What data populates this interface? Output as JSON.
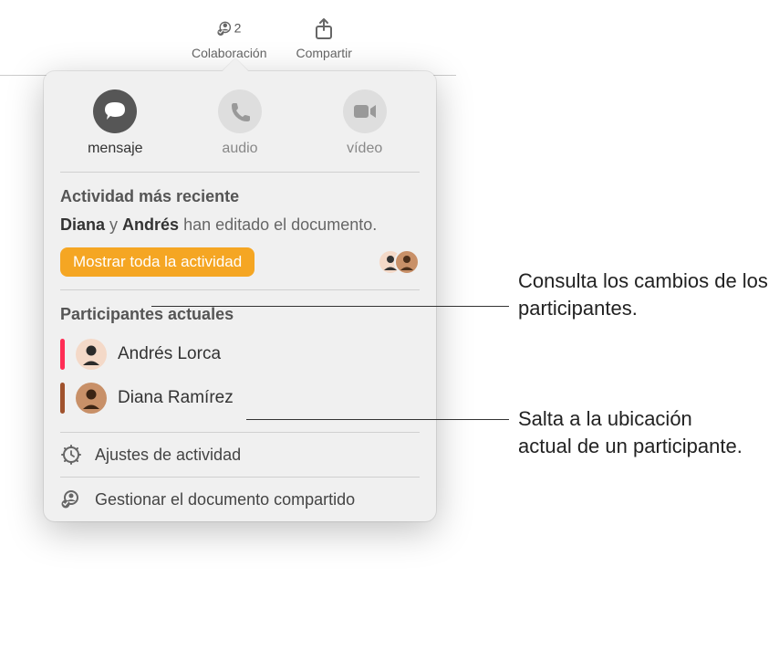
{
  "toolbar": {
    "collaboration_label": "Colaboración",
    "collaboration_count": "2",
    "share_label": "Compartir"
  },
  "actions": {
    "message": "mensaje",
    "audio": "audio",
    "video": "vídeo"
  },
  "activity": {
    "title": "Actividad más reciente",
    "editor1": "Diana",
    "conjunction": " y ",
    "editor2": "Andrés",
    "suffix": " han editado el documento.",
    "show_all": "Mostrar toda la actividad"
  },
  "participants": {
    "title": "Participantes actuales",
    "list": [
      {
        "name": "Andrés Lorca",
        "color": "#ff2d55",
        "avatar_bg": "#f4d9c8"
      },
      {
        "name": "Diana Ramírez",
        "color": "#a0522d",
        "avatar_bg": "#c89068"
      }
    ]
  },
  "footer": {
    "activity_settings": "Ajustes de actividad",
    "manage_shared": "Gestionar el documento compartido"
  },
  "callouts": {
    "changes": "Consulta los cambios de los participantes.",
    "jump": "Salta a la ubicación actual de un participante."
  }
}
